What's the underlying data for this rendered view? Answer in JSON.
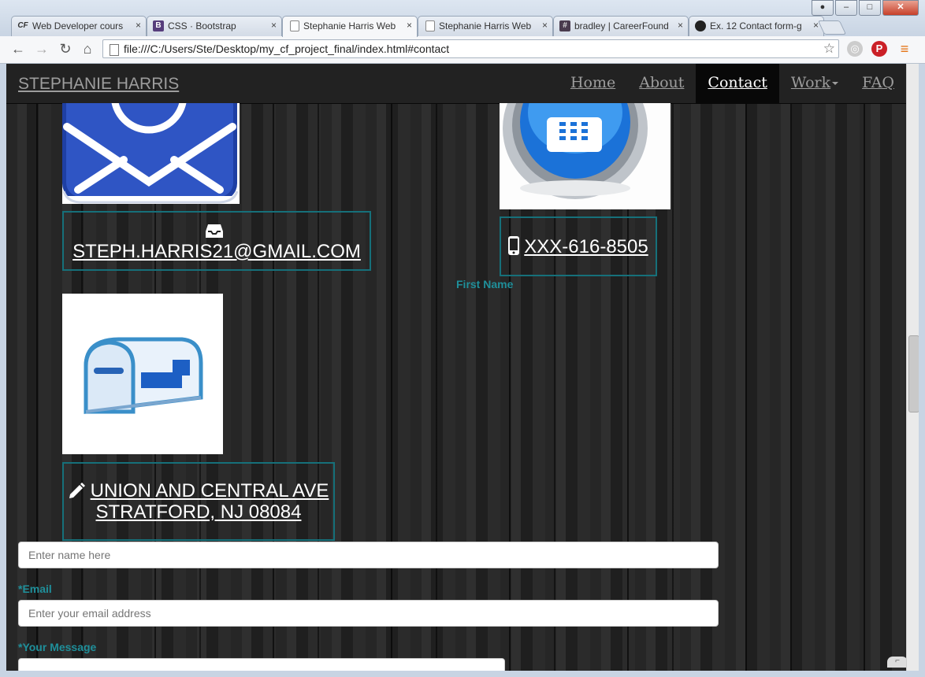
{
  "browser": {
    "tabs": [
      {
        "favicon": "CF",
        "title": "Web Developer cours",
        "active": false
      },
      {
        "favicon": "B",
        "title": "CSS · Bootstrap",
        "active": false
      },
      {
        "favicon": "",
        "title": "Stephanie Harris Web",
        "active": true
      },
      {
        "favicon": "",
        "title": "Stephanie Harris Web",
        "active": false
      },
      {
        "favicon": "#",
        "title": "bradley | CareerFound",
        "active": false
      },
      {
        "favicon": "gh",
        "title": "Ex. 12 Contact form-g",
        "active": false
      }
    ],
    "close_glyph": "×",
    "url": "file:///C:/Users/Ste/Desktop/my_cf_project_final/index.html#contact",
    "nav": {
      "back": "←",
      "forward": "→",
      "reload": "↻",
      "home": "⌂"
    },
    "star": "☆"
  },
  "site": {
    "brand": "STEPHANIE HARRIS",
    "nav": [
      {
        "label": "Home",
        "active": false
      },
      {
        "label": "About",
        "active": false
      },
      {
        "label": "Contact",
        "active": true
      },
      {
        "label": "Work",
        "active": false,
        "dropdown": true
      },
      {
        "label": "FAQ",
        "active": false
      }
    ]
  },
  "contact": {
    "email": "STEPH.HARRIS21@GMAIL.COM",
    "phone": "XXX-616-8505",
    "address_line1": "UNION AND CENTRAL AVE",
    "address_line2": "STRATFORD, NJ 08084"
  },
  "form": {
    "first_name_label": "First Name",
    "name_placeholder": "Enter name here",
    "email_label": "*Email",
    "email_placeholder": "Enter your email address",
    "message_label": "*Your Message"
  },
  "colors": {
    "accent": "#1f8f9a",
    "box_border": "#16707a",
    "navbar": "#222222"
  }
}
